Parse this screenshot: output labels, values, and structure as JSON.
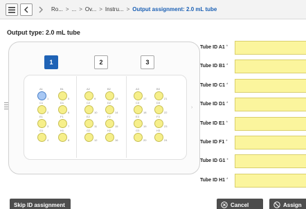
{
  "breadcrumb": {
    "items": [
      "Ro...",
      "...",
      "Ov...",
      "Instru..."
    ],
    "separator": ">",
    "current": "Output assignment: 2.0 mL tube"
  },
  "output_type": "Output type: 2.0 mL tube",
  "racks": [
    {
      "label": "1",
      "selected": true
    },
    {
      "label": "2",
      "selected": false
    },
    {
      "label": "3",
      "selected": false
    }
  ],
  "rack_wells": [
    [
      "A1",
      "B1",
      "A2",
      "B2",
      "A3",
      "B3"
    ],
    [
      "C1",
      "D1",
      "C2",
      "D2",
      "C3",
      "D3"
    ],
    [
      "E1",
      "F1",
      "E2",
      "F2",
      "E3",
      "F3"
    ],
    [
      "G1",
      "H1",
      "G2",
      "H2",
      "G3",
      "H3"
    ]
  ],
  "well_numbers": [
    [
      "1",
      "5",
      "9",
      "13",
      "17",
      "21"
    ],
    [
      "2",
      "6",
      "10",
      "14",
      "18",
      "22"
    ],
    [
      "3",
      "7",
      "11",
      "15",
      "19",
      "23"
    ],
    [
      "4",
      "8",
      "12",
      "16",
      "20",
      "24"
    ]
  ],
  "tube_fields": [
    {
      "label": "Tube ID A1",
      "required": "*",
      "value": ""
    },
    {
      "label": "Tube ID B1",
      "required": "*",
      "value": ""
    },
    {
      "label": "Tube ID C1",
      "required": "*",
      "value": ""
    },
    {
      "label": "Tube ID D1",
      "required": "*",
      "value": ""
    },
    {
      "label": "Tube ID E1",
      "required": "*",
      "value": ""
    },
    {
      "label": "Tube ID F1",
      "required": "*",
      "value": ""
    },
    {
      "label": "Tube ID G1",
      "required": "*",
      "value": ""
    },
    {
      "label": "Tube ID H1",
      "required": "*",
      "value": ""
    }
  ],
  "buttons": {
    "skip": "Skip ID assignment",
    "cancel": "Cancel",
    "assign": "Assign"
  },
  "colors": {
    "accent": "#1f63b6",
    "well_fill": "#f6ef8a",
    "field_fill": "#fbf59d",
    "button_dark": "#4d4d4d"
  },
  "icons": {
    "menu": "menu-icon",
    "back": "chevron-left-icon",
    "forward": "chevron-right-icon",
    "cancel": "close-circle-icon",
    "assign": "no-entry-icon"
  }
}
